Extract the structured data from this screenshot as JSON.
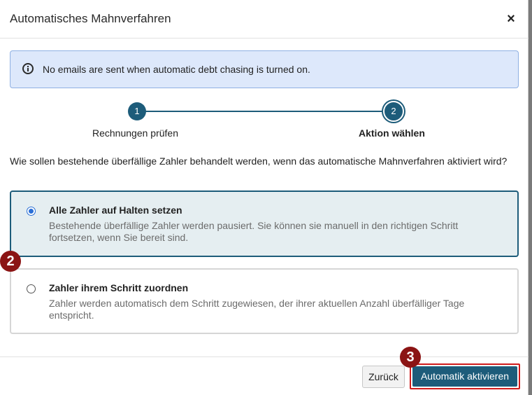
{
  "dialog": {
    "title": "Automatisches Mahnverfahren",
    "close_symbol": "×",
    "close_icon": "close-icon"
  },
  "info": {
    "icon": "info-icon",
    "text": "No emails are sent when automatic debt chasing is turned on."
  },
  "stepper": {
    "steps": [
      {
        "number": "1",
        "label": "Rechnungen prüfen",
        "state": "completed"
      },
      {
        "number": "2",
        "label": "Aktion wählen",
        "state": "active"
      }
    ],
    "color": "#1d5c7a"
  },
  "question": "Wie sollen bestehende überfällige Zahler behandelt werden, wenn das automatische Mahnverfahren aktiviert wird?",
  "options": [
    {
      "title": "Alle Zahler auf Halten setzen",
      "description": "Bestehende überfällige Zahler werden pausiert. Sie können sie manuell in den richtigen Schritt fortsetzen, wenn Sie bereit sind.",
      "selected": true
    },
    {
      "title": "Zahler ihrem Schritt zuordnen",
      "description": "Zahler werden automatisch dem Schritt zugewiesen, der ihrer aktuellen Anzahl überfälliger Tage entspricht.",
      "selected": false
    }
  ],
  "markers": [
    "2",
    "3"
  ],
  "footer": {
    "back_label": "Zurück",
    "activate_label": "Automatik aktivieren"
  },
  "colors": {
    "primary": "#1d5c7a",
    "marker": "#8b1414",
    "highlight_border": "#d01b1b",
    "info_bg": "#dde8fb"
  }
}
